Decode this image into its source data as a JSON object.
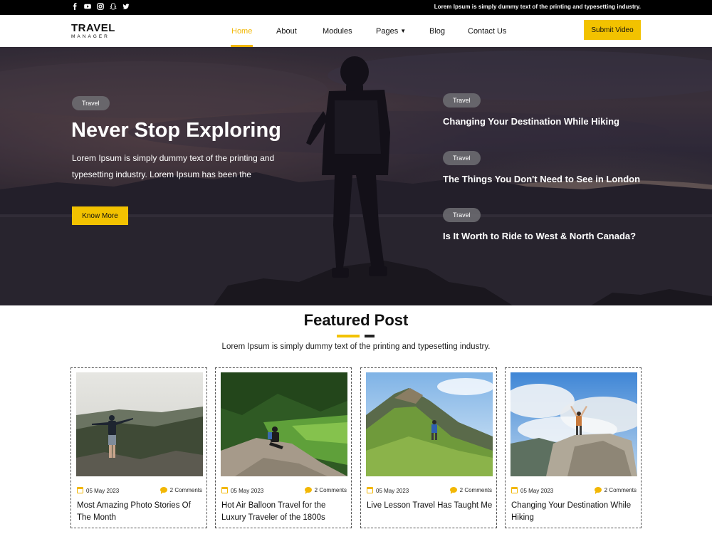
{
  "colors": {
    "accent": "#f2c200",
    "dark": "#000000",
    "pill": "#6e6e73"
  },
  "topbar": {
    "social_icons": [
      "facebook-icon",
      "youtube-icon",
      "instagram-icon",
      "snapchat-icon",
      "twitter-icon"
    ],
    "tagline": "Lorem Ipsum is simply dummy text of the printing and typesetting industry."
  },
  "logo": {
    "main": "TRAVEL",
    "sub": "MANAGER"
  },
  "nav": {
    "items": [
      {
        "label": "Home"
      },
      {
        "label": "About"
      },
      {
        "label": "Modules"
      },
      {
        "label": "Pages"
      },
      {
        "label": "Blog"
      },
      {
        "label": "Contact Us"
      }
    ],
    "cta": "Submit Video"
  },
  "hero": {
    "tag": "Travel",
    "title": "Never Stop Exploring",
    "description": "Lorem Ipsum is simply dummy text of the printing and typesetting industry. Lorem Ipsum has been the",
    "button": "Know More",
    "side_posts": [
      {
        "tag": "Travel",
        "title": "Changing Your Destination While Hiking"
      },
      {
        "tag": "Travel",
        "title": "The Things You Don't Need to See in London"
      },
      {
        "tag": "Travel",
        "title": "Is It Worth to Ride to West & North Canada?"
      }
    ]
  },
  "featured": {
    "title": "Featured Post",
    "subtitle": "Lorem Ipsum is simply dummy text of the printing and typesetting industry.",
    "cards": [
      {
        "date": "05 May 2023",
        "comments": "2 Comments",
        "title": "Most Amazing Photo Stories Of The Month"
      },
      {
        "date": "05 May 2023",
        "comments": "2 Comments",
        "title": "Hot Air Balloon Travel for the Luxury Traveler of the 1800s"
      },
      {
        "date": "05 May 2023",
        "comments": "2 Comments",
        "title": "Live Lesson Travel Has Taught Me"
      },
      {
        "date": "05 May 2023",
        "comments": "2 Comments",
        "title": "Changing Your Destination While Hiking"
      }
    ]
  }
}
